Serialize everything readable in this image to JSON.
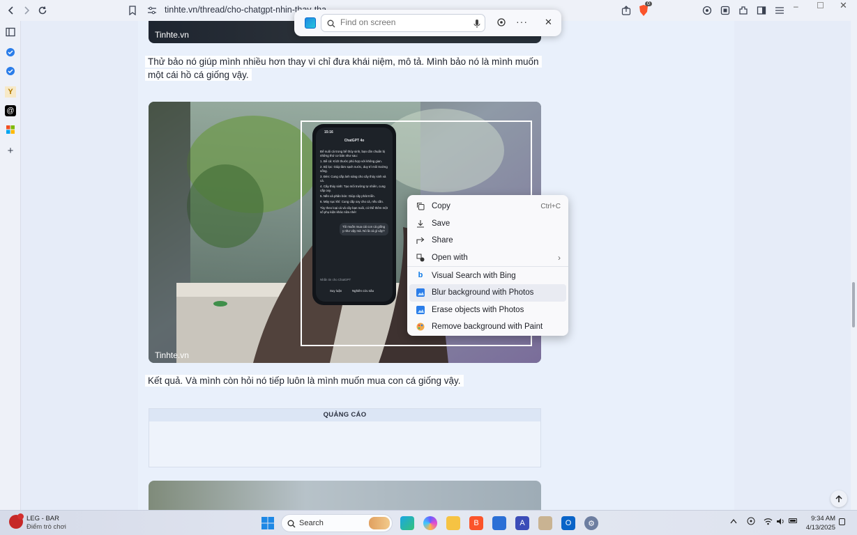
{
  "browser": {
    "url": "tinhte.vn/thread/cho-chatgpt-nhin-thay-tha...",
    "brave_badge": "0"
  },
  "article": {
    "watermark_top": "Tinhte.vn",
    "paragraph1": "Thử bảo nó giúp mình nhiều hơn thay vì chỉ đưa khái niệm, mô tả. Mình bảo nó là mình muốn một cái hồ cá giống vậy.",
    "photo_watermark": "Tinhte.vn",
    "paragraph2": "Kết quả. Và mình còn hỏi nó tiếp luôn là mình muốn mua con cá giống vậy.",
    "ad_label": "QUẢNG CÁO"
  },
  "phone": {
    "time": "15:16",
    "title": "ChatGPT 4o",
    "intro": "Để nuôi cá trong bể thủy sinh, bạn cần chuẩn bị những thứ cơ bản như sau:",
    "items": [
      "1. Bể cá: Kích thước phù hợp với không gian.",
      "2. Bộ lọc: Giúp làm sạch nước, duy trì môi trường sống.",
      "3. Đèn: Cung cấp ánh sáng cho cây thủy sinh và cá.",
      "4. Cây thủy sinh: Tạo môi trường tự nhiên, cung cấp oxy.",
      "5. Nền và phân bón: Giúp cây phát triển.",
      "6. Máy sục khí: Cung cấp oxy cho cá, nếu cần."
    ],
    "outro": "Tùy theo loại cá và cây bạn nuôi, có thể thêm một số phụ kiện khác nữa nhé!",
    "user_msg": "Tôi muốn mua cái con cá giống y như vậy mà. Nó là cá gì vậy?",
    "input_placeholder": "Nhắn tin cho ChatGPT",
    "btn_think": "Suy luận",
    "btn_search": "Nghiên cứu sâu"
  },
  "findbar": {
    "placeholder": "Find on screen"
  },
  "context_menu": {
    "items": [
      {
        "label": "Copy",
        "shortcut": "Ctrl+C"
      },
      {
        "label": "Save"
      },
      {
        "label": "Share"
      },
      {
        "label": "Open with"
      },
      {
        "label": "Visual Search with Bing"
      },
      {
        "label": "Blur background with Photos"
      },
      {
        "label": "Erase objects with Photos"
      },
      {
        "label": "Remove background with Paint"
      }
    ]
  },
  "taskbar": {
    "widget_title": "LEG - BAR",
    "widget_sub": "Điểm trò chơi",
    "search_label": "Search",
    "time": "9:34 AM",
    "date": "4/13/2025"
  },
  "colors": {
    "accent": "#0b57d0",
    "page_bg": "#e9f0fb",
    "brave": "#fb542b"
  }
}
